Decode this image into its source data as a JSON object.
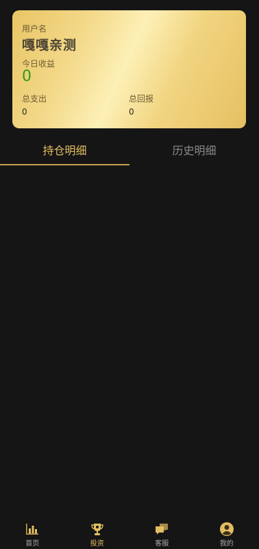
{
  "card": {
    "username_label": "用户名",
    "username": "嘎嘎亲测",
    "today_income_label": "今日收益",
    "today_income": "0",
    "total_expense_label": "总支出",
    "total_expense": "0",
    "total_return_label": "总回报",
    "total_return": "0"
  },
  "tabs": [
    {
      "label": "持仓明细"
    },
    {
      "label": "历史明细"
    }
  ],
  "nav": [
    {
      "label": "首页",
      "icon": "bar-chart-icon"
    },
    {
      "label": "投资",
      "icon": "trophy-icon"
    },
    {
      "label": "客服",
      "icon": "chat-icon"
    },
    {
      "label": "我的",
      "icon": "user-icon"
    }
  ],
  "colors": {
    "accent": "#e2bd63",
    "income": "#2b9a1a",
    "background": "#151515"
  }
}
